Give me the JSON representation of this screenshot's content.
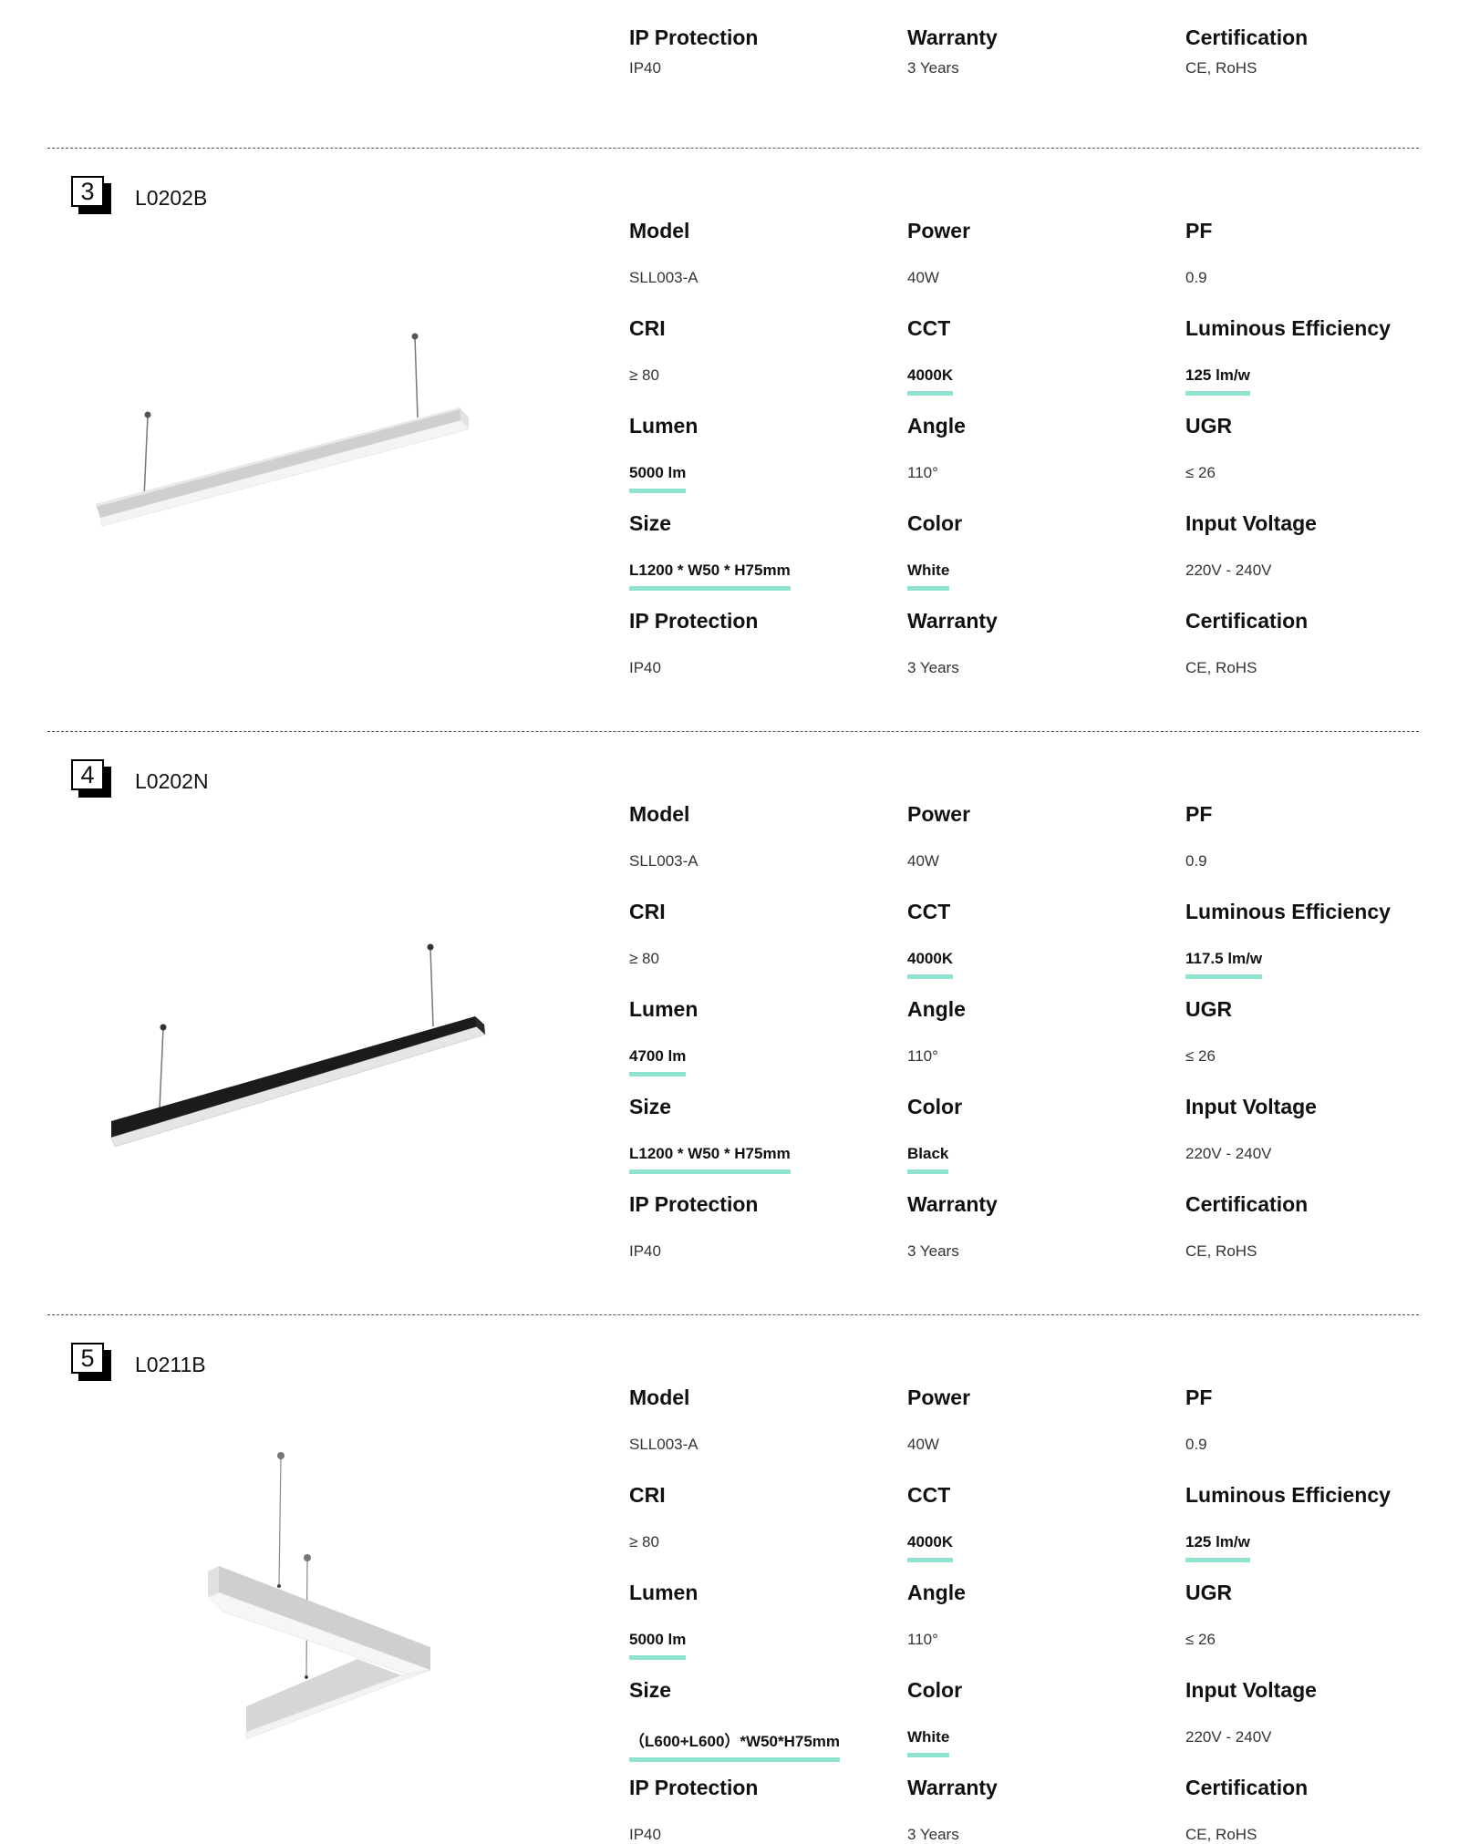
{
  "accent_color": "#8fe3cf",
  "top_partial": {
    "specs": [
      {
        "label": "IP Protection",
        "value": "IP40"
      },
      {
        "label": "Warranty",
        "value": "3 Years"
      },
      {
        "label": "Certification",
        "value": "CE, RoHS"
      }
    ]
  },
  "products": [
    {
      "number": "3",
      "code": "L0202B",
      "image": "white-linear-pendant-light",
      "specs": [
        {
          "label": "Model",
          "value": "SLL003-A",
          "highlight": false
        },
        {
          "label": "Power",
          "value": "40W",
          "highlight": false
        },
        {
          "label": "PF",
          "value": "0.9",
          "highlight": false
        },
        {
          "label": "CRI",
          "value": "≥ 80",
          "highlight": false
        },
        {
          "label": "CCT",
          "value": "4000K",
          "highlight": true
        },
        {
          "label": "Luminous Efficiency",
          "value": "125 lm/w",
          "highlight": true
        },
        {
          "label": "Lumen",
          "value": "5000 lm",
          "highlight": true
        },
        {
          "label": "Angle",
          "value": "110°",
          "highlight": false
        },
        {
          "label": "UGR",
          "value": "≤ 26",
          "highlight": false
        },
        {
          "label": "Size",
          "value": "L1200 * W50 * H75mm",
          "highlight": true
        },
        {
          "label": "Color",
          "value": "White",
          "highlight": true
        },
        {
          "label": "Input Voltage",
          "value": "220V - 240V",
          "highlight": false
        },
        {
          "label": "IP Protection",
          "value": "IP40",
          "highlight": false
        },
        {
          "label": "Warranty",
          "value": "3 Years",
          "highlight": false
        },
        {
          "label": "Certification",
          "value": "CE, RoHS",
          "highlight": false
        }
      ]
    },
    {
      "number": "4",
      "code": "L0202N",
      "image": "black-linear-pendant-light",
      "specs": [
        {
          "label": "Model",
          "value": "SLL003-A",
          "highlight": false
        },
        {
          "label": "Power",
          "value": "40W",
          "highlight": false
        },
        {
          "label": "PF",
          "value": "0.9",
          "highlight": false
        },
        {
          "label": "CRI",
          "value": "≥ 80",
          "highlight": false
        },
        {
          "label": "CCT",
          "value": "4000K",
          "highlight": true
        },
        {
          "label": "Luminous Efficiency",
          "value": "117.5 lm/w",
          "highlight": true
        },
        {
          "label": "Lumen",
          "value": "4700 lm",
          "highlight": true
        },
        {
          "label": "Angle",
          "value": "110°",
          "highlight": false
        },
        {
          "label": "UGR",
          "value": "≤ 26",
          "highlight": false
        },
        {
          "label": "Size",
          "value": "L1200 * W50 * H75mm",
          "highlight": true
        },
        {
          "label": "Color",
          "value": "Black",
          "highlight": true
        },
        {
          "label": "Input Voltage",
          "value": "220V - 240V",
          "highlight": false
        },
        {
          "label": "IP Protection",
          "value": "IP40",
          "highlight": false
        },
        {
          "label": "Warranty",
          "value": "3 Years",
          "highlight": false
        },
        {
          "label": "Certification",
          "value": "CE, RoHS",
          "highlight": false
        }
      ]
    },
    {
      "number": "5",
      "code": "L0211B",
      "image": "white-v-shaped-pendant-light",
      "specs": [
        {
          "label": "Model",
          "value": "SLL003-A",
          "highlight": false
        },
        {
          "label": "Power",
          "value": "40W",
          "highlight": false
        },
        {
          "label": "PF",
          "value": "0.9",
          "highlight": false
        },
        {
          "label": "CRI",
          "value": "≥ 80",
          "highlight": false
        },
        {
          "label": "CCT",
          "value": "4000K",
          "highlight": true
        },
        {
          "label": "Luminous Efficiency",
          "value": "125 lm/w",
          "highlight": true
        },
        {
          "label": "Lumen",
          "value": "5000 lm",
          "highlight": true
        },
        {
          "label": "Angle",
          "value": "110°",
          "highlight": false
        },
        {
          "label": "UGR",
          "value": "≤ 26",
          "highlight": false
        },
        {
          "label": "Size",
          "value": "（L600+L600）*W50*H75mm",
          "highlight": true
        },
        {
          "label": "Color",
          "value": "White",
          "highlight": true
        },
        {
          "label": "Input Voltage",
          "value": "220V - 240V",
          "highlight": false
        },
        {
          "label": "IP Protection",
          "value": "IP40",
          "highlight": false
        },
        {
          "label": "Warranty",
          "value": "3 Years",
          "highlight": false
        },
        {
          "label": "Certification",
          "value": "CE, RoHS",
          "highlight": false
        }
      ]
    }
  ]
}
